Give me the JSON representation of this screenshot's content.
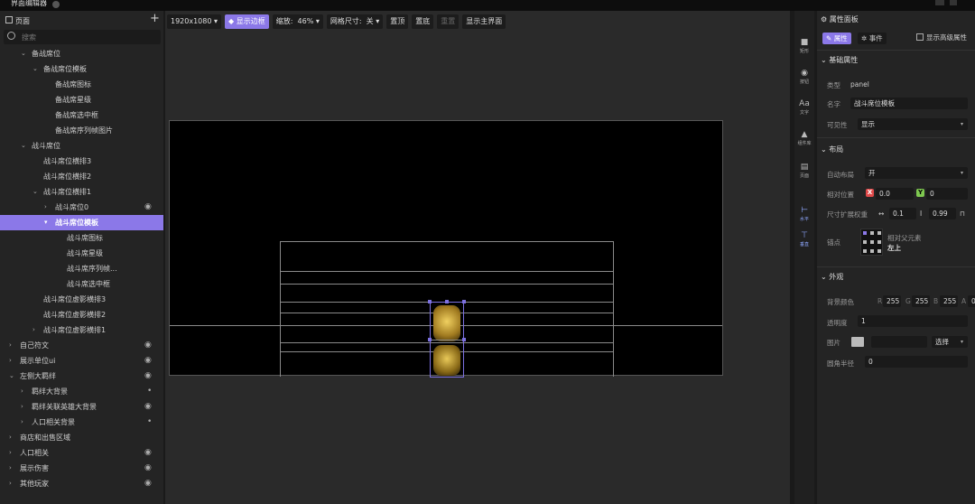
{
  "window": {
    "title": "界面编辑器"
  },
  "left_panel": {
    "header": "页面",
    "add_label": "+",
    "search_placeholder": "搜索",
    "tree": [
      {
        "label": "备战席位",
        "indent": 1,
        "arrow": "⌄"
      },
      {
        "label": "备战席位模板",
        "indent": 2,
        "arrow": "⌄"
      },
      {
        "label": "备战席图标",
        "indent": 3,
        "arrow": ""
      },
      {
        "label": "备战席星级",
        "indent": 3,
        "arrow": ""
      },
      {
        "label": "备战席选中框",
        "indent": 3,
        "arrow": ""
      },
      {
        "label": "备战席序列帧图片",
        "indent": 3,
        "arrow": ""
      },
      {
        "label": "战斗席位",
        "indent": 1,
        "arrow": "⌄"
      },
      {
        "label": "战斗席位横排3",
        "indent": 2,
        "arrow": ""
      },
      {
        "label": "战斗席位横排2",
        "indent": 2,
        "arrow": ""
      },
      {
        "label": "战斗席位横排1",
        "indent": 2,
        "arrow": "⌄"
      },
      {
        "label": "战斗席位0",
        "indent": 3,
        "arrow": "›",
        "eye": true
      },
      {
        "label": "战斗席位模板",
        "indent": 3,
        "arrow": "▾",
        "selected": true
      },
      {
        "label": "战斗席图标",
        "indent": 4,
        "arrow": ""
      },
      {
        "label": "战斗席星级",
        "indent": 4,
        "arrow": ""
      },
      {
        "label": "战斗席序列帧...",
        "indent": 4,
        "arrow": ""
      },
      {
        "label": "战斗席选中框",
        "indent": 4,
        "arrow": ""
      },
      {
        "label": "战斗席位虚影横排3",
        "indent": 2,
        "arrow": ""
      },
      {
        "label": "战斗席位虚影横排2",
        "indent": 2,
        "arrow": ""
      },
      {
        "label": "战斗席位虚影横排1",
        "indent": 2,
        "arrow": "›"
      },
      {
        "label": "自己符文",
        "indent": 0,
        "arrow": "›",
        "eye": true
      },
      {
        "label": "展示单位ui",
        "indent": 0,
        "arrow": "›",
        "eye": true
      },
      {
        "label": "左侧大羁绊",
        "indent": 0,
        "arrow": "⌄",
        "eye": true
      },
      {
        "label": "羁绊大背景",
        "indent": 1,
        "arrow": "›",
        "dot": true
      },
      {
        "label": "羁绊关联英雄大背景",
        "indent": 1,
        "arrow": "›",
        "eye": true
      },
      {
        "label": "人口相关背景",
        "indent": 1,
        "arrow": "›",
        "dot": true
      },
      {
        "label": "商店和出售区域",
        "indent": 0,
        "arrow": "›"
      },
      {
        "label": "人口相关",
        "indent": 0,
        "arrow": "›",
        "eye": true
      },
      {
        "label": "展示伤害",
        "indent": 0,
        "arrow": "›",
        "eye": true
      },
      {
        "label": "其他玩家",
        "indent": 0,
        "arrow": "›",
        "eye": true
      }
    ]
  },
  "toolbar": {
    "resolution": "1920x1080",
    "show_border": "显示边框",
    "zoom_label": "缩放:",
    "zoom_value": "46%",
    "grid_label": "网格尺寸:",
    "grid_value": "关",
    "top": "置顶",
    "bottom": "置底",
    "reset": "重置",
    "show_main": "显示主界面"
  },
  "side_bar": [
    {
      "icon": "rect-icon",
      "glyph": "■",
      "label": "矩形"
    },
    {
      "icon": "button-icon",
      "glyph": "◉",
      "label": "按钮"
    },
    {
      "icon": "text-icon",
      "glyph": "Aa",
      "label": "文字"
    },
    {
      "icon": "component-lib-icon",
      "glyph": "▲",
      "label": "组件库"
    },
    {
      "icon": "page-icon",
      "glyph": "▤",
      "label": "页面"
    },
    {
      "icon": "horizontal-icon",
      "glyph": "⊢",
      "label": "水平",
      "active": true
    },
    {
      "icon": "vertical-icon",
      "glyph": "⊤",
      "label": "垂直",
      "active": true
    }
  ],
  "props": {
    "title": "属性面板",
    "tab_attr": "属性",
    "tab_event": "事件",
    "show_advanced": "显示高级属性",
    "basic_section": "基础属性",
    "type_label": "类型",
    "type_value": "panel",
    "name_label": "名字",
    "name_value": "战斗席位模板",
    "visibility_label": "可见性",
    "visibility_value": "显示",
    "layout_section": "布局",
    "auto_layout_label": "自动布局",
    "auto_layout_value": "开",
    "rel_pos_label": "相对位置",
    "x_tag": "X",
    "x_value": "0.0",
    "y_tag": "Y",
    "y_value": "0",
    "size_weight_label": "尺寸扩展权重",
    "w_value": "0.1",
    "h_value": "0.99",
    "anchor_label": "锚点",
    "anchor_rel": "相对父元素",
    "anchor_value": "左上",
    "appearance_section": "外观",
    "bg_color_label": "背景颜色",
    "r_tag": "R",
    "r_value": "255",
    "g_tag": "G",
    "g_value": "255",
    "b_tag": "B",
    "b_value": "255",
    "a_tag": "A",
    "a_value": "0",
    "opacity_label": "透明度",
    "opacity_value": "1",
    "image_label": "图片",
    "image_select": "选择",
    "radius_label": "圆角半径",
    "radius_value": "0"
  },
  "colors": {
    "accent": "#8b78e8",
    "x_red": "#e04a4a",
    "y_green": "#7ec850",
    "gold": "#c8a030"
  }
}
